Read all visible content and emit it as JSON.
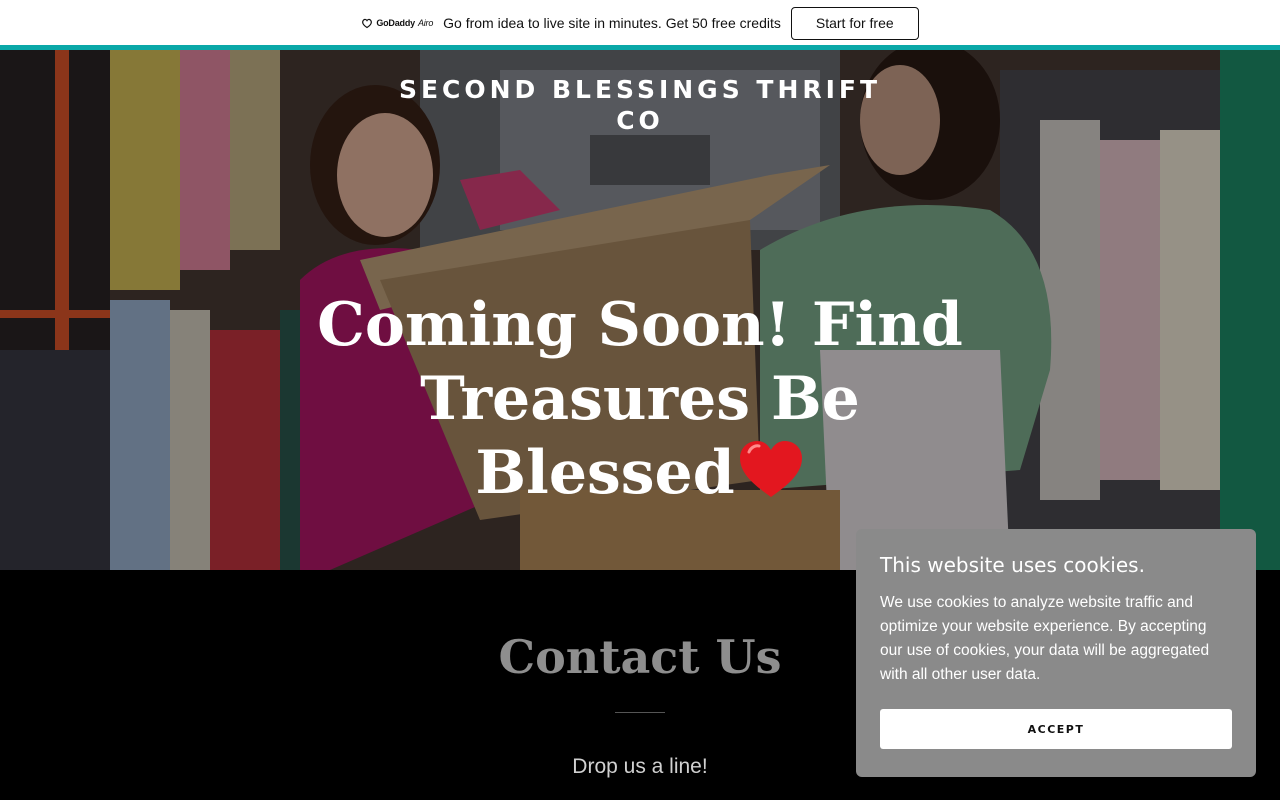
{
  "promo": {
    "logo_brand": "GoDaddy",
    "logo_product": "Airo",
    "text": "Go from idea to live site in minutes. Get 50 free credits",
    "button": "Start for free",
    "stripe_color": "#0aa8a8"
  },
  "hero": {
    "site_title": "SECOND BLESSINGS THRIFT CO",
    "heading": "Coming Soon! Find Treasures Be Blessed",
    "heading_emoji": "red-heart-emoji"
  },
  "contact": {
    "title": "Contact Us",
    "subtitle": "Drop us a line!"
  },
  "cookie": {
    "title": "This website uses cookies.",
    "text": "We use cookies to analyze website traffic and optimize your website experience. By accepting our use of cookies, your data will be aggregated with all other user data.",
    "button": "ACCEPT"
  }
}
